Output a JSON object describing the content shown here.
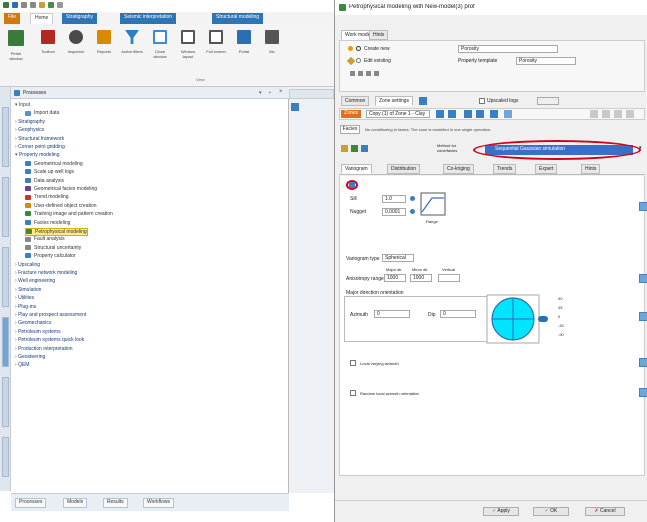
{
  "ribbon": {
    "tabs": [
      "File",
      "Home",
      "Stratigraphy",
      "Seismic interpretation",
      "Structural modeling"
    ],
    "buttons": [
      {
        "label": "Petrel window",
        "icon": "petrel-icon",
        "color": "#3a7a3a"
      },
      {
        "label": "Toolbox",
        "icon": "toolbox-icon",
        "color": "#b22a1e"
      },
      {
        "label": "Inspector",
        "icon": "magnifier-icon",
        "color": "#4a4a4a"
      },
      {
        "label": "Reports",
        "icon": "report-icon",
        "color": "#d98a00"
      },
      {
        "label": "Active filters",
        "icon": "filter-icon",
        "color": "#2a7fc9"
      },
      {
        "label": "Clone window",
        "icon": "window-icon",
        "color": "#3a8bd6"
      },
      {
        "label": "Window layout",
        "icon": "layout-icon",
        "color": "#555"
      },
      {
        "label": "Full screen",
        "icon": "fullscreen-icon",
        "color": "#555"
      },
      {
        "label": "Portal",
        "icon": "portal-icon",
        "color": "#2a6fb4"
      },
      {
        "label": "Mo",
        "icon": "more-icon",
        "color": "#555"
      }
    ],
    "group_label": "View"
  },
  "left_pane": {
    "title": "Processes",
    "items": [
      {
        "label": "Input",
        "level": 0
      },
      {
        "label": "Import data",
        "level": 1,
        "icon_color": "#5b8fd0"
      },
      {
        "label": "Stratigraphy",
        "level": 0
      },
      {
        "label": "Geophysics",
        "level": 0
      },
      {
        "label": "Structural framework",
        "level": 0
      },
      {
        "label": "Corner point gridding",
        "level": 0
      },
      {
        "label": "Property modeling",
        "level": 0
      },
      {
        "label": "Geometrical modeling",
        "level": 1,
        "icon_color": "#3a7fbf"
      },
      {
        "label": "Scale up well logs",
        "level": 1,
        "icon_color": "#3a7fbf"
      },
      {
        "label": "Data analysis",
        "level": 1,
        "icon_color": "#3a7fbf"
      },
      {
        "label": "Geometrical facies modeling",
        "level": 1,
        "icon_color": "#6b3fa0"
      },
      {
        "label": "Trend modeling",
        "level": 1,
        "icon_color": "#c0392b"
      },
      {
        "label": "User-defined object creation",
        "level": 1,
        "icon_color": "#d98a00"
      },
      {
        "label": "Training image and pattern creation",
        "level": 1,
        "icon_color": "#3a8a3a"
      },
      {
        "label": "Facies modeling",
        "level": 1,
        "icon_color": "#3a7fbf"
      },
      {
        "label": "Petrophysical modeling",
        "level": 1,
        "icon_color": "#3a8a3a",
        "highlight": true
      },
      {
        "label": "Fault analysis",
        "level": 1,
        "icon_color": "#888888"
      },
      {
        "label": "Structural uncertainty",
        "level": 1,
        "icon_color": "#888888"
      },
      {
        "label": "Property calculator",
        "level": 1,
        "icon_color": "#3a7fbf"
      },
      {
        "label": "Upscaling",
        "level": 0
      },
      {
        "label": "Fracture network modeling",
        "level": 0
      },
      {
        "label": "Well engineering",
        "level": 0
      },
      {
        "label": "Simulation",
        "level": 0
      },
      {
        "label": "Utilities",
        "level": 0
      },
      {
        "label": "Plug-ins",
        "level": 0
      },
      {
        "label": "Play and prospect assessment",
        "level": 0
      },
      {
        "label": "Geomechanics",
        "level": 0
      },
      {
        "label": "Petroleum systems",
        "level": 0
      },
      {
        "label": "Petroleum systems quick look",
        "level": 0
      },
      {
        "label": "Production interpretation",
        "level": 0
      },
      {
        "label": "Geosteering",
        "level": 0
      },
      {
        "label": "QEM",
        "level": 0
      }
    ],
    "bottom_tabs": [
      "Processes",
      "Models",
      "Results",
      "Workflows"
    ]
  },
  "dialog": {
    "title": "Petrophysical modeling with New-model(3) prof",
    "tabs": [
      "Work model",
      "Hints"
    ],
    "create_new_label": "Create new",
    "create_new_value": "Porosity",
    "edit_existing_label": "Edit existing",
    "property_template_label": "Property template",
    "property_template_value": "Porosity",
    "subtabs": [
      "Common",
      "Zone settings"
    ],
    "upscaled_label": "Upscaled logs",
    "zones_label": "Zones",
    "zones_value": "Copy (1) of Zone 1 - Clay",
    "facies_label": "Facies",
    "facies_note": "No conditioning to facies. The zone is modelled in one single operation.",
    "method_label": "Method for zone/facies",
    "method_value": "Sequential Gaussian simulation",
    "method_tabs": [
      "Variogram",
      "Distribution",
      "Co-kriging",
      "Trends",
      "Expert",
      "Hints"
    ],
    "sill_label": "Sill",
    "sill_value": "1.0",
    "nugget_label": "Nugget",
    "nugget_value": "0.0001",
    "range_label": "Range",
    "variogram_type_label": "Variogram type",
    "variogram_type_value": "Spherical",
    "major_dir_label": "Major dir.",
    "minor_dir_label": "Minor dir.",
    "vertical_label": "Vertical",
    "anisotropy_label": "Anisotropy range",
    "major_value": "1000",
    "minor_value": "1000",
    "vertical_value": "[rendered below]",
    "orientation_label": "Major direction orientation",
    "azimuth_label": "Azimuth",
    "azimuth_value": "0",
    "dip_label": "Dip",
    "dip_value": "0",
    "dial_ticks": [
      "90",
      "45",
      "0",
      "-45",
      "-90"
    ],
    "local_varying_label": "Local varying azimuth",
    "random_seed_label": "Random local azimuth orientation",
    "apply_label": "Apply",
    "ok_label": "OK",
    "cancel_label": "Cancel",
    "colors": {
      "annotation_red": "#d0021b",
      "dial_cyan": "#00e5ff",
      "method_bg": "#3a6fc8",
      "selected_zone": "#e07020"
    }
  }
}
